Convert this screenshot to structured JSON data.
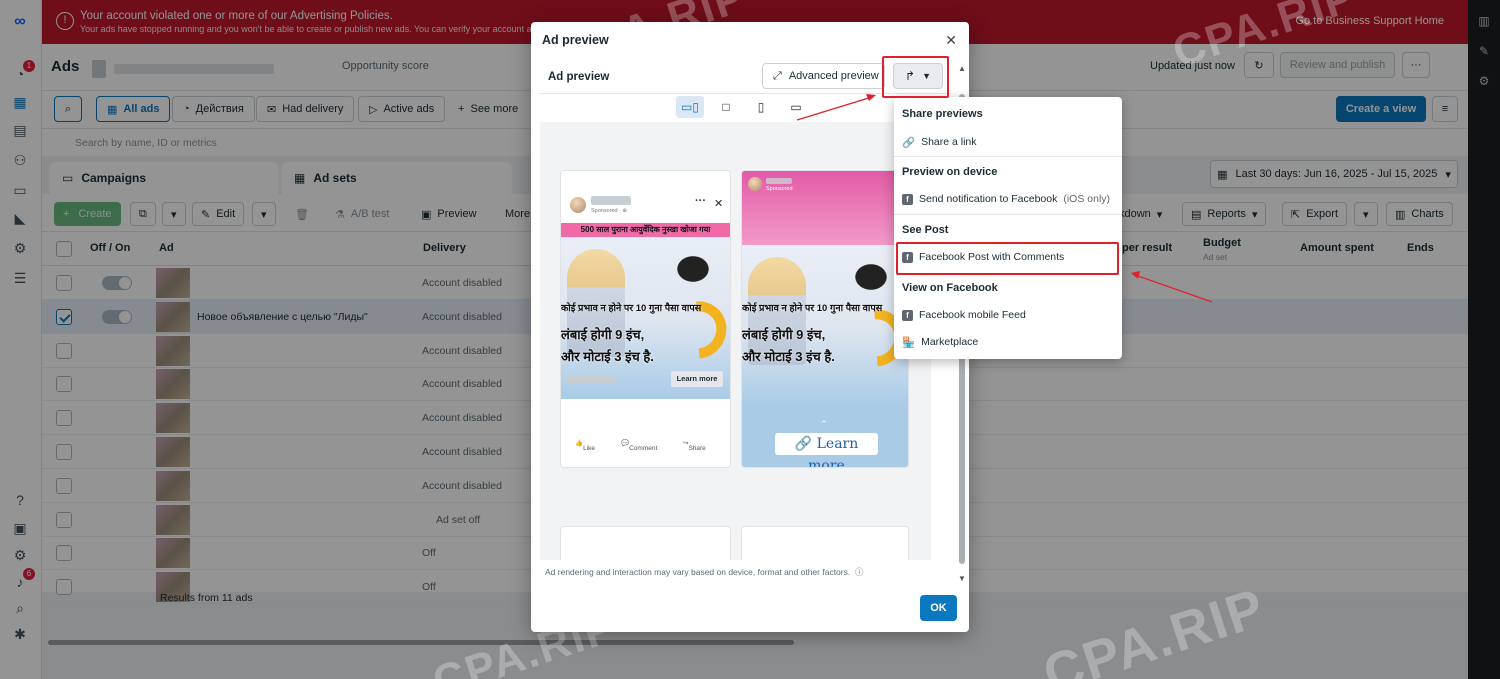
{
  "alert": {
    "title": "Your account violated one or more of our Advertising Policies.",
    "subtitle": "Your ads have stopped running and you won't be able to create or publish new ads. You can verify your account and",
    "link": "Go to Business Support Home"
  },
  "left_rail": {
    "badge_top": "1",
    "badge_bottom": "6"
  },
  "header": {
    "title": "Ads",
    "opportunity": "Opportunity score",
    "updated": "Updated just now",
    "review_publish": "Review and publish",
    "more": "···"
  },
  "filters": {
    "all_ads": "All ads",
    "actions": "Действия",
    "had_delivery": "Had delivery",
    "active_ads": "Active ads",
    "see_more": "See more",
    "create_view": "Create a view"
  },
  "search": {
    "placeholder": "Search by name, ID or metrics"
  },
  "level_tabs": {
    "campaigns": "Campaigns",
    "ad_sets": "Ad sets"
  },
  "date_range": "Last 30 days: Jun 16, 2025 - Jul 15, 2025",
  "toolbar": {
    "create": "Create",
    "edit": "Edit",
    "ab_test": "A/B test",
    "preview": "Preview",
    "more": "More",
    "breakdown": "kdown",
    "reports": "Reports",
    "export": "Export",
    "charts": "Charts"
  },
  "table": {
    "headers": {
      "off_on": "Off / On",
      "ad": "Ad",
      "delivery": "Delivery",
      "per_result": "per result",
      "budget": "Budget",
      "budget_sub": "Ad set",
      "amount_spent": "Amount spent",
      "ends": "Ends"
    },
    "rows": [
      {
        "name": "",
        "delivery": "Account disabled"
      },
      {
        "name": "Новое объявление с целью \"Лиды\"",
        "delivery": "Account disabled"
      },
      {
        "name": "",
        "delivery": "Account disabled"
      },
      {
        "name": "",
        "delivery": "Account disabled"
      },
      {
        "name": "",
        "delivery": "Account disabled"
      },
      {
        "name": "",
        "delivery": "Account disabled"
      },
      {
        "name": "",
        "delivery": "Account disabled"
      },
      {
        "name": "",
        "delivery": "Ad set off"
      },
      {
        "name": "",
        "delivery": "Off"
      },
      {
        "name": "",
        "delivery": "Off"
      }
    ],
    "results": "Results from 11 ads"
  },
  "modal": {
    "title": "Ad preview",
    "section_label": "Ad preview",
    "advanced_preview": "Advanced preview",
    "footnote": "Ad rendering and interaction may vary based on device, format and other factors.",
    "ok": "OK",
    "feed_card": {
      "sponsored": "Sponsored · ⊕",
      "banner": "500 साल पुराना आयुर्वेदिक नुस्खा खोजा गया",
      "line1": "कोई प्रभाव न होने पर 10 गुना पैसा वापस",
      "line2": "लंबाई होगी 9 इंच,",
      "line3": "और मोटाई 3 इंच है.",
      "learn_more": "Learn more",
      "like": "Like",
      "comment": "Comment",
      "share": "Share"
    },
    "story_card": {
      "sponsored": "Sponsored",
      "line1": "कोई प्रभाव न होने पर 10 गुना पैसा वापस",
      "line2": "लंबाई होगी 9 इंच,",
      "line3": "और मोटाई 3 इंच है.",
      "learn_more": "Learn more"
    }
  },
  "share_menu": {
    "share_previews": "Share previews",
    "share_link": "Share a link",
    "preview_on_device": "Preview on device",
    "send_notification": "Send notification to Facebook",
    "ios_only": "(iOS only)",
    "see_post": "See Post",
    "fb_post_comments": "Facebook Post with Comments",
    "view_on_facebook": "View on Facebook",
    "fb_mobile_feed": "Facebook mobile Feed",
    "marketplace": "Marketplace"
  },
  "watermark": "CPA.RIP",
  "colors": {
    "accent": "#0a78be",
    "alert": "#c0182c",
    "highlight": "#e0202a"
  }
}
